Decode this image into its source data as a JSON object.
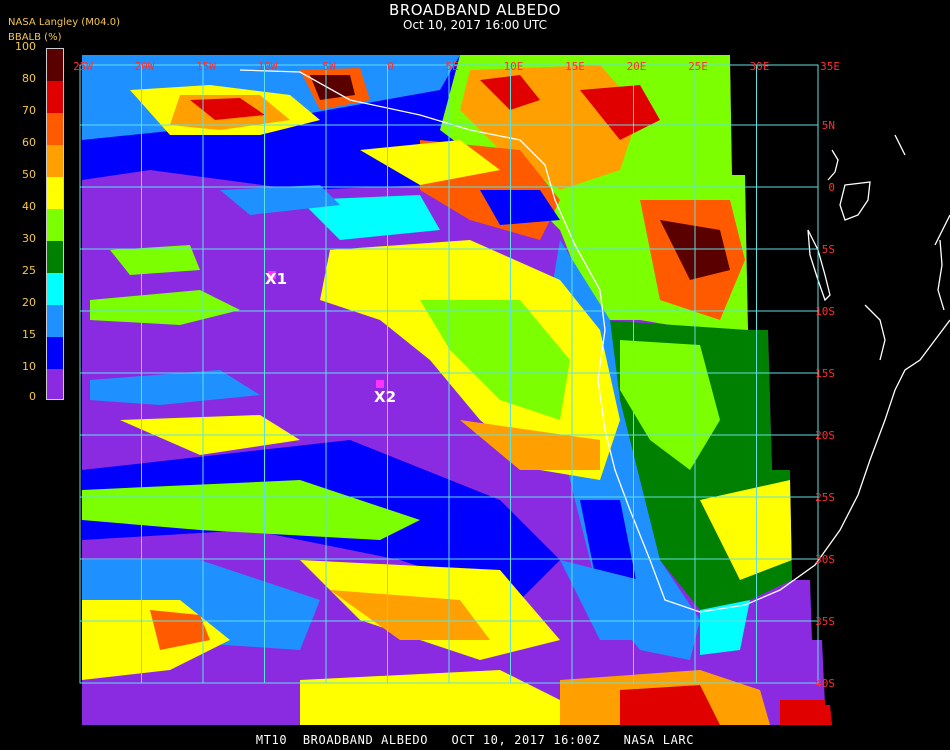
{
  "header": {
    "title": "BROADBAND ALBEDO",
    "datetime": "Oct 10, 2017 16:00 UTC",
    "source": "NASA Langley (M04.0)",
    "unit": "BBALB (%)"
  },
  "legend": {
    "ticks": [
      "100",
      "80",
      "70",
      "60",
      "50",
      "40",
      "30",
      "25",
      "20",
      "15",
      "10",
      "0"
    ],
    "bands": [
      {
        "from": 80,
        "to": 100,
        "color": "#5a0000"
      },
      {
        "from": 70,
        "to": 80,
        "color": "#e00000"
      },
      {
        "from": 60,
        "to": 70,
        "color": "#ff5a00"
      },
      {
        "from": 50,
        "to": 60,
        "color": "#ffa000"
      },
      {
        "from": 40,
        "to": 50,
        "color": "#ffff00"
      },
      {
        "from": 30,
        "to": 40,
        "color": "#7cff00"
      },
      {
        "from": 25,
        "to": 30,
        "color": "#008000"
      },
      {
        "from": 20,
        "to": 25,
        "color": "#00ffff"
      },
      {
        "from": 15,
        "to": 20,
        "color": "#1e90ff"
      },
      {
        "from": 10,
        "to": 15,
        "color": "#0000ff"
      },
      {
        "from": 0,
        "to": 10,
        "color": "#8a2be2"
      }
    ]
  },
  "map": {
    "lon_labels": [
      "25W",
      "20W",
      "15W",
      "10W",
      "5W",
      "0",
      "5E",
      "10E",
      "15E",
      "20E",
      "25E",
      "30E",
      "35E"
    ],
    "lat_labels": [
      "5N",
      "0",
      "5S",
      "10S",
      "15S",
      "20S",
      "25S",
      "30S",
      "35S",
      "40S"
    ],
    "markers": [
      {
        "label": "X1"
      },
      {
        "label": "X2"
      }
    ],
    "grid_color": "#5fe0e0",
    "label_color": "#ff3030"
  },
  "footer": {
    "text": "MT10  BROADBAND ALBEDO   OCT 10, 2017 16:00Z   NASA LARC"
  }
}
